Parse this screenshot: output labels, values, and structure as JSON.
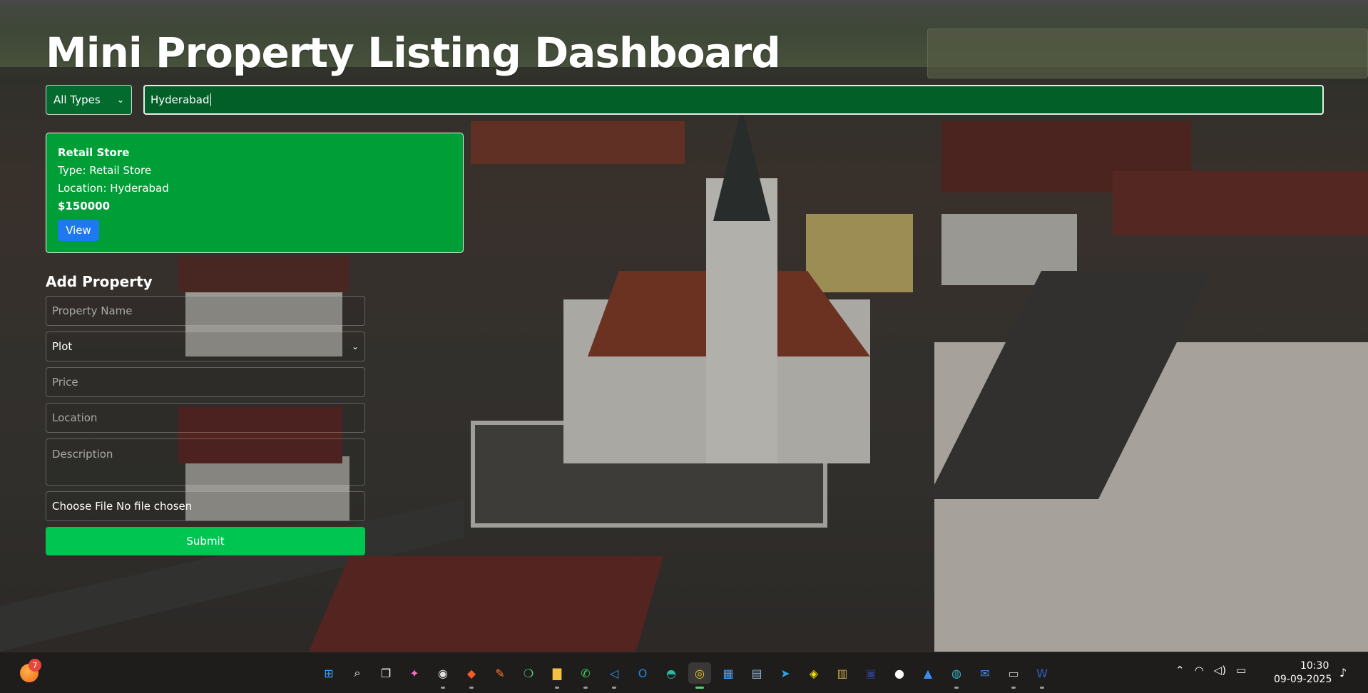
{
  "app": {
    "title": "Mini Property Listing Dashboard"
  },
  "filters": {
    "type_selected": "All Types",
    "search_value": "Hyderabad"
  },
  "listings": [
    {
      "name": "Retail Store",
      "type_line": "Type: Retail Store",
      "location_line": "Location: Hyderabad",
      "price": "$150000",
      "view_label": "View"
    }
  ],
  "form": {
    "title": "Add Property",
    "name_placeholder": "Property Name",
    "type_selected": "Plot",
    "price_placeholder": "Price",
    "location_placeholder": "Location",
    "description_placeholder": "Description",
    "file_label": "Choose File No file chosen",
    "submit_label": "Submit"
  },
  "taskbar": {
    "notification_count": "7",
    "apps": [
      {
        "name": "windows-start-icon",
        "glyph": "⊞",
        "color": "#3aa0ff"
      },
      {
        "name": "search-icon",
        "glyph": "⌕",
        "color": "#ffffff"
      },
      {
        "name": "task-view-icon",
        "glyph": "❐",
        "color": "#ffffff"
      },
      {
        "name": "copilot-icon",
        "glyph": "✦",
        "color": "#f06ec8"
      },
      {
        "name": "whatsapp-beta-icon",
        "glyph": "◉",
        "color": "#e0e0e0"
      },
      {
        "name": "brave-icon",
        "glyph": "◆",
        "color": "#f25b2a"
      },
      {
        "name": "orange-app-icon",
        "glyph": "✎",
        "color": "#ff7a2e"
      },
      {
        "name": "mongodb-compass-icon",
        "glyph": "❍",
        "color": "#5fd08a"
      },
      {
        "name": "file-explorer-icon",
        "glyph": "▇",
        "color": "#f5c242"
      },
      {
        "name": "whatsapp-icon",
        "glyph": "✆",
        "color": "#3fd160"
      },
      {
        "name": "vscode-icon",
        "glyph": "◁",
        "color": "#2d9cf0"
      },
      {
        "name": "outlook-icon",
        "glyph": "O",
        "color": "#1e88e5"
      },
      {
        "name": "edge-icon",
        "glyph": "◓",
        "color": "#2bb8a5"
      },
      {
        "name": "chrome-icon",
        "glyph": "◎",
        "color": "#f0c020"
      },
      {
        "name": "microsoft-store-icon",
        "glyph": "▦",
        "color": "#4aa3ff"
      },
      {
        "name": "calculator-icon",
        "glyph": "▤",
        "color": "#8fb3d9"
      },
      {
        "name": "telegram-icon",
        "glyph": "➤",
        "color": "#2aa3e6"
      },
      {
        "name": "snapchat-icon",
        "glyph": "◈",
        "color": "#f7e400"
      },
      {
        "name": "chart-app-icon",
        "glyph": "▥",
        "color": "#c9a24a"
      },
      {
        "name": "dark-app-icon",
        "glyph": "▣",
        "color": "#2c3b7a"
      },
      {
        "name": "github-icon",
        "glyph": "●",
        "color": "#ffffff"
      },
      {
        "name": "photos-icon",
        "glyph": "▲",
        "color": "#3b8ef0"
      },
      {
        "name": "network-app-icon",
        "glyph": "◍",
        "color": "#39b0c9"
      },
      {
        "name": "mail-icon",
        "glyph": "✉",
        "color": "#3a8ee8"
      },
      {
        "name": "terminal-icon",
        "glyph": "▭",
        "color": "#cfcfcf"
      },
      {
        "name": "word-icon",
        "glyph": "W",
        "color": "#2b64c8"
      }
    ],
    "time": "10:30",
    "date": "09-09-2025"
  }
}
